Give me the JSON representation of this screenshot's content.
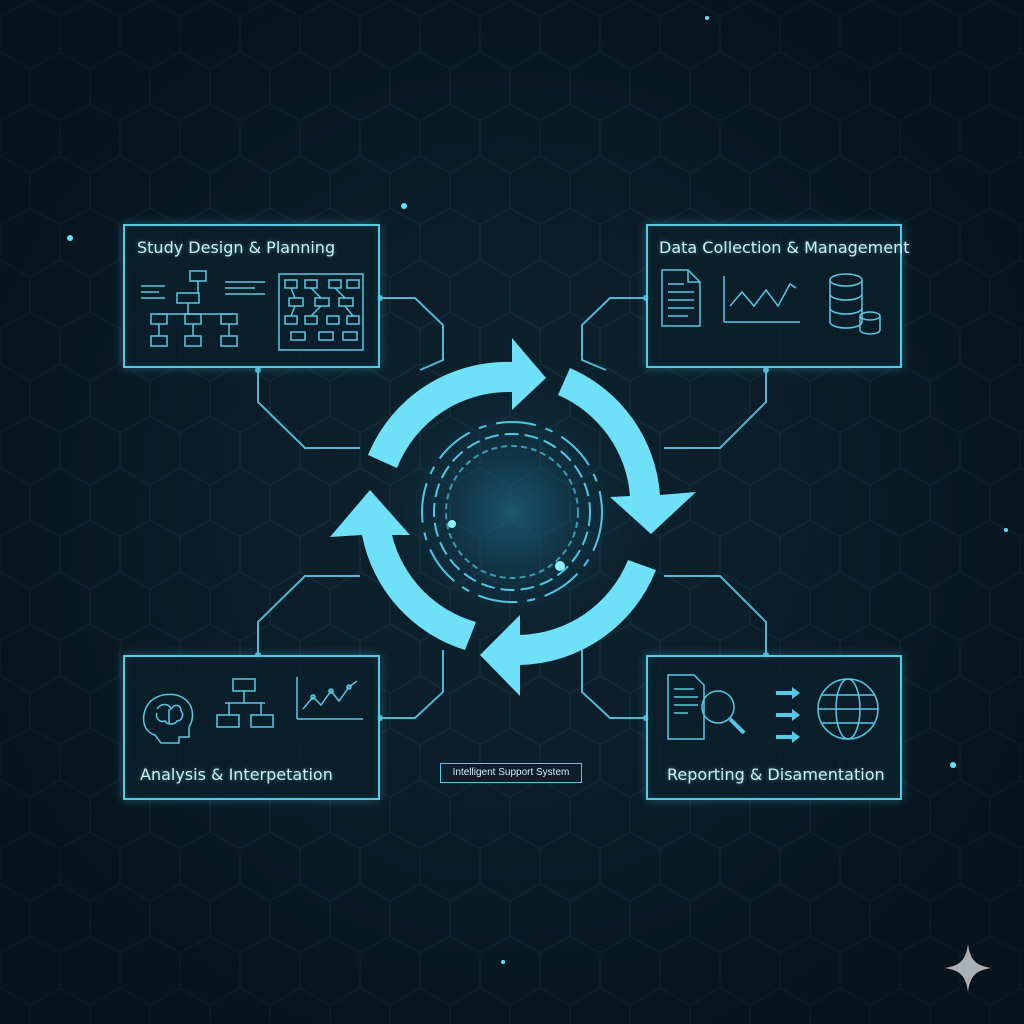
{
  "colors": {
    "background": "#0b1a24",
    "accent": "#56c9e4",
    "arrow": "#6ee0f7",
    "text": "#cfeff8"
  },
  "panels": {
    "top_left": {
      "title": "Study Design & Planning"
    },
    "top_right": {
      "title": "Data Collection & Management"
    },
    "bottom_left": {
      "title": "Analysis & Interpetation"
    },
    "bottom_right": {
      "title": "Reporting & Disamentation"
    }
  },
  "center": {
    "label": "Intelligent Support System"
  },
  "icons": {
    "top_left": [
      "flowchart-icon",
      "network-diagram-icon"
    ],
    "top_right": [
      "document-icon",
      "line-chart-icon",
      "database-icon"
    ],
    "bottom_left": [
      "brain-head-icon",
      "flowchart-icon",
      "scatter-chart-icon"
    ],
    "bottom_right": [
      "document-search-icon",
      "transfer-arrows-icon",
      "globe-icon"
    ]
  }
}
